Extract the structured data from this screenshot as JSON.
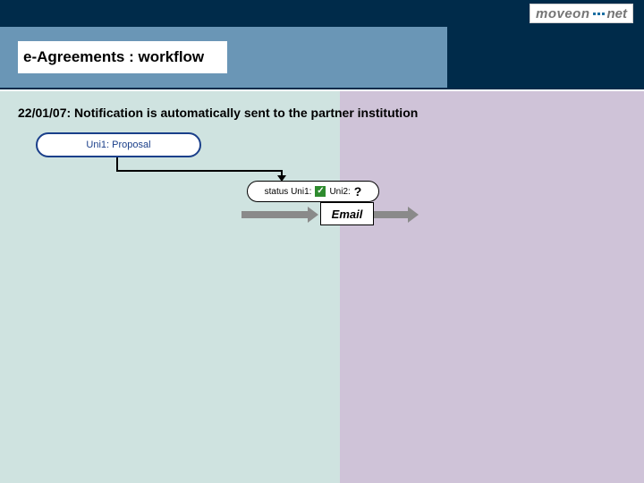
{
  "logo": {
    "part1": "moveon",
    "part2": "net"
  },
  "title": "e-Agreements : workflow",
  "subtitle": "22/01/07: Notification is automatically sent to the partner institution",
  "proposal": {
    "label": "Uni1: Proposal"
  },
  "status": {
    "uni1_label": "status Uni1:",
    "uni1_value": "✓",
    "uni2_label": "Uni2:",
    "uni2_value": "?"
  },
  "email_label": "Email"
}
